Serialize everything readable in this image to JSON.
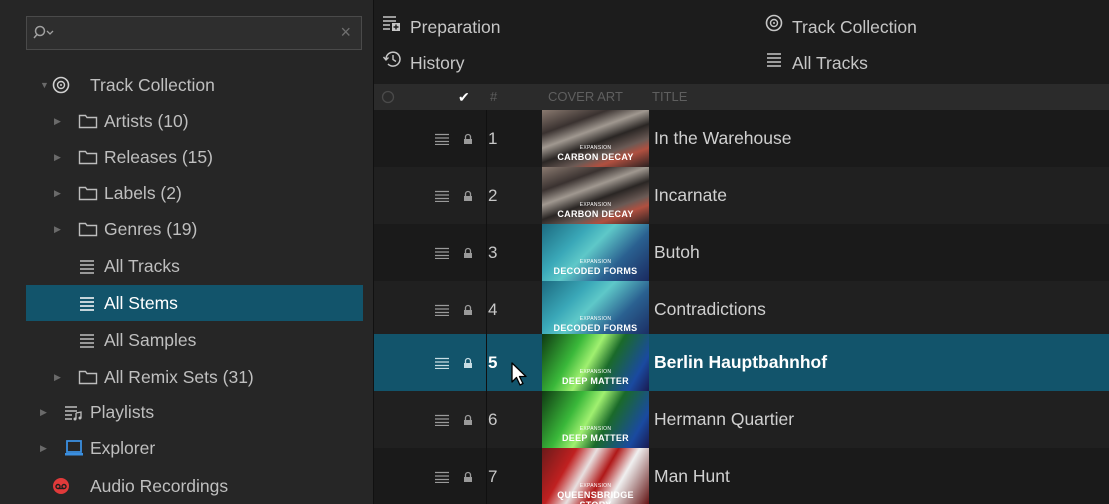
{
  "search": {
    "clear_icon": "×"
  },
  "sidebar": {
    "items": [
      {
        "label": "Track Collection",
        "icon": "collection-icon"
      },
      {
        "label": "Artists (10)",
        "icon": "folder-icon"
      },
      {
        "label": "Releases (15)",
        "icon": "folder-icon"
      },
      {
        "label": "Labels (2)",
        "icon": "folder-icon"
      },
      {
        "label": "Genres (19)",
        "icon": "folder-icon"
      },
      {
        "label": "All Tracks",
        "icon": "list-icon"
      },
      {
        "label": "All Stems",
        "icon": "list-icon",
        "selected": true
      },
      {
        "label": "All Samples",
        "icon": "list-icon"
      },
      {
        "label": "All Remix Sets (31)",
        "icon": "folder-icon"
      },
      {
        "label": "Playlists",
        "icon": "playlist-icon"
      },
      {
        "label": "Explorer",
        "icon": "computer-icon"
      },
      {
        "label": "Audio Recordings",
        "icon": "record-icon"
      }
    ]
  },
  "favorites": {
    "preparation": "Preparation",
    "history": "History",
    "track_collection": "Track Collection",
    "all_tracks": "All Tracks"
  },
  "columns": {
    "check": "✔",
    "number": "#",
    "cover_art": "COVER ART",
    "title": "TITLE"
  },
  "tracks": [
    {
      "num": "1",
      "title": "In the Warehouse",
      "cover_line1": "EXPANSION",
      "cover_line2": "CARBON DECAY"
    },
    {
      "num": "2",
      "title": "Incarnate",
      "cover_line1": "EXPANSION",
      "cover_line2": "CARBON DECAY"
    },
    {
      "num": "3",
      "title": "Butoh",
      "cover_line1": "EXPANSION",
      "cover_line2": "DECODED FORMS"
    },
    {
      "num": "4",
      "title": "Contradictions",
      "cover_line1": "EXPANSION",
      "cover_line2": "DECODED FORMS"
    },
    {
      "num": "5",
      "title": "Berlin Hauptbahnhof",
      "cover_line1": "EXPANSION",
      "cover_line2": "DEEP MATTER",
      "selected": true
    },
    {
      "num": "6",
      "title": "Hermann Quartier",
      "cover_line1": "EXPANSION",
      "cover_line2": "DEEP MATTER"
    },
    {
      "num": "7",
      "title": "Man Hunt",
      "cover_line1": "EXPANSION",
      "cover_line2": "QUEENSBRIDGE STORY"
    }
  ],
  "colors": {
    "selection": "#12546b",
    "record_red": "#e03a3a",
    "explorer_blue": "#3a8fe0"
  }
}
